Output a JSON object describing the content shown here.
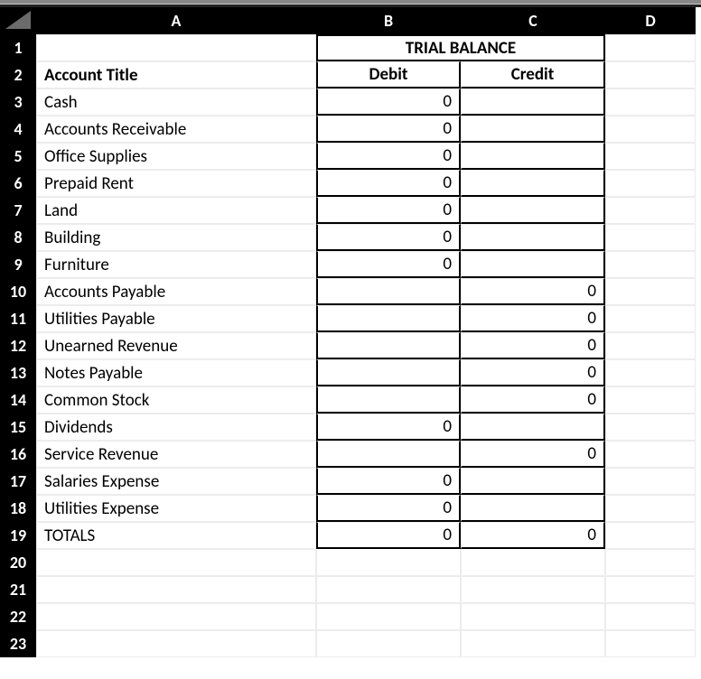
{
  "chart_data": {
    "type": "table",
    "title": "TRIAL BALANCE",
    "columns": [
      "Account Title",
      "Debit",
      "Credit"
    ]
  },
  "columns": {
    "A": "A",
    "B": "B",
    "C": "C",
    "D": "D"
  },
  "rows": [
    "1",
    "2",
    "3",
    "4",
    "5",
    "6",
    "7",
    "8",
    "9",
    "10",
    "11",
    "12",
    "13",
    "14",
    "15",
    "16",
    "17",
    "18",
    "19",
    "20",
    "21",
    "22",
    "23"
  ],
  "r1": {
    "bc": "TRIAL BALANCE"
  },
  "r2": {
    "a": "Account Title",
    "b": "Debit",
    "c": "Credit"
  },
  "r3": {
    "a": "Cash",
    "b": "0",
    "c": ""
  },
  "r4": {
    "a": "Accounts Receivable",
    "b": "0",
    "c": ""
  },
  "r5": {
    "a": "Office Supplies",
    "b": "0",
    "c": ""
  },
  "r6": {
    "a": "Prepaid Rent",
    "b": "0",
    "c": ""
  },
  "r7": {
    "a": "Land",
    "b": "0",
    "c": ""
  },
  "r8": {
    "a": "Building",
    "b": "0",
    "c": ""
  },
  "r9": {
    "a": "Furniture",
    "b": "0",
    "c": ""
  },
  "r10": {
    "a": "Accounts Payable",
    "b": "",
    "c": "0"
  },
  "r11": {
    "a": "Utilities Payable",
    "b": "",
    "c": "0"
  },
  "r12": {
    "a": "Unearned Revenue",
    "b": "",
    "c": "0"
  },
  "r13": {
    "a": "Notes Payable",
    "b": "",
    "c": "0"
  },
  "r14": {
    "a": "Common Stock",
    "b": "",
    "c": "0"
  },
  "r15": {
    "a": "Dividends",
    "b": "0",
    "c": ""
  },
  "r16": {
    "a": "Service Revenue",
    "b": "",
    "c": "0"
  },
  "r17": {
    "a": "Salaries Expense",
    "b": "0",
    "c": ""
  },
  "r18": {
    "a": "Utilities Expense",
    "b": "0",
    "c": ""
  },
  "r19": {
    "a": "TOTALS",
    "b": "0",
    "c": "0"
  }
}
